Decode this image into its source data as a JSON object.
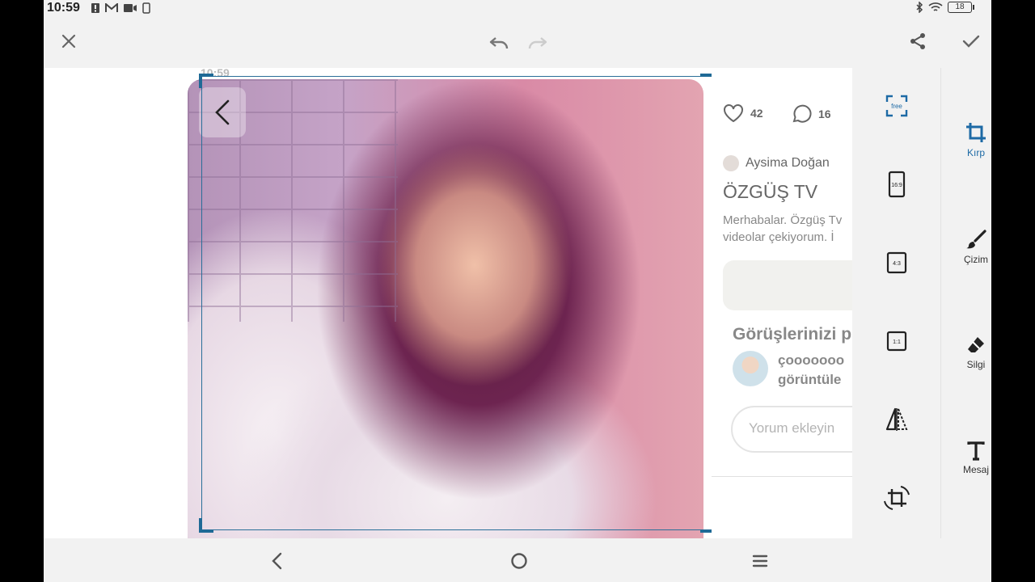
{
  "status_bar": {
    "time": "10:59",
    "battery": "18"
  },
  "topbar": {
    "close_icon": "close-icon",
    "undo_icon": "undo-icon",
    "redo_icon": "redo-icon",
    "share_icon": "share-icon",
    "confirm_icon": "check-icon"
  },
  "canvas": {
    "ghost_time": "10:59",
    "side_panel": {
      "likes": "42",
      "comments": "16",
      "author": "Aysima Doğan",
      "title": "ÖZGÜŞ TV",
      "description_line1": "Merhabalar. Özgüş Tv",
      "description_line2": "videolar çekiyorum. İ",
      "opinions_heading": "Görüşlerinizi p",
      "comment_line1": "çooooooo",
      "comment_line2": "görüntüle",
      "comment_placeholder": "Yorum ekleyin"
    }
  },
  "crop_tools": [
    {
      "name": "free",
      "label": "free"
    },
    {
      "name": "ratio-16-9",
      "label": "16:9"
    },
    {
      "name": "ratio-4-3",
      "label": "4:3"
    },
    {
      "name": "ratio-1-1",
      "label": "1:1"
    },
    {
      "name": "flip",
      "label": ""
    },
    {
      "name": "rotate",
      "label": ""
    }
  ],
  "right_rail": [
    {
      "label": "Kırp",
      "icon": "crop-icon",
      "active": true
    },
    {
      "label": "Çizim",
      "icon": "brush-icon",
      "active": false
    },
    {
      "label": "Silgi",
      "icon": "eraser-icon",
      "active": false
    },
    {
      "label": "Mesaj",
      "icon": "text-icon",
      "active": false
    }
  ],
  "colors": {
    "accent": "#1d6aa5",
    "crop_frame": "#2a6f99"
  }
}
